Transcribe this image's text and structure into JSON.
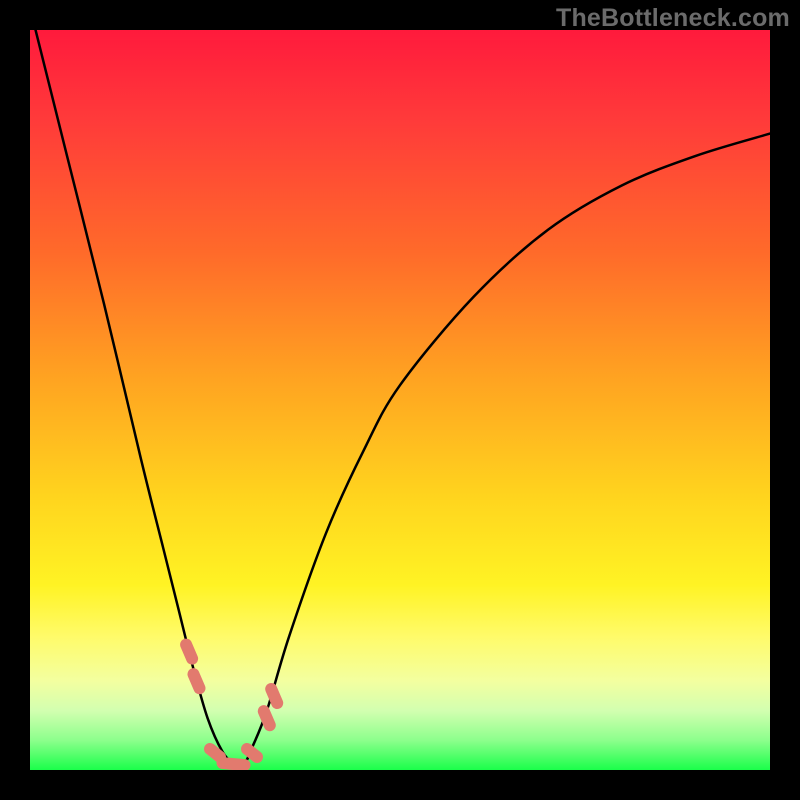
{
  "watermark": "TheBottleneck.com",
  "colors": {
    "frame": "#000000",
    "watermark_text": "#6b6b6b",
    "curve": "#000000",
    "marker": "#e27a6e",
    "gradient_top": "#ff1a3c",
    "gradient_mid1": "#ffa321",
    "gradient_mid2": "#fff324",
    "gradient_bottom": "#1aff4a"
  },
  "chart_data": {
    "type": "line",
    "title": "",
    "xlabel": "",
    "ylabel": "",
    "xlim": [
      0,
      100
    ],
    "ylim": [
      0,
      100
    ],
    "series": [
      {
        "name": "bottleneck-curve",
        "x": [
          0,
          5,
          10,
          15,
          18,
          20,
          22,
          24,
          26,
          27.5,
          29,
          30,
          32,
          35,
          40,
          45,
          50,
          60,
          70,
          80,
          90,
          100
        ],
        "values": [
          103,
          83,
          63,
          42,
          30,
          22,
          14,
          7,
          2.5,
          1,
          1,
          3,
          8,
          18,
          32,
          43,
          52,
          64,
          73,
          79,
          83,
          86
        ]
      }
    ],
    "markers": [
      {
        "name": "left-descent-dot",
        "x": 21.5,
        "y": 16
      },
      {
        "name": "left-descent-dot2",
        "x": 22.5,
        "y": 12
      },
      {
        "name": "valley-left-dash",
        "x": 25,
        "y": 2.3
      },
      {
        "name": "valley-floor",
        "x": 27.5,
        "y": 0.8
      },
      {
        "name": "valley-right-dash",
        "x": 30,
        "y": 2.3
      },
      {
        "name": "right-ascent-dot",
        "x": 32,
        "y": 7
      },
      {
        "name": "right-ascent-dot2",
        "x": 33,
        "y": 10
      }
    ],
    "notes": "Axes are unlabeled in the source image; x and y are normalized 0–100. values represent height from the bottom (0 = green bottom edge, 100 = red top edge). The curve plunges from top-left into a narrow minimum near x≈27.5 then rises asymptotically toward the upper right. Pink/coral markers cluster around the minimum."
  }
}
